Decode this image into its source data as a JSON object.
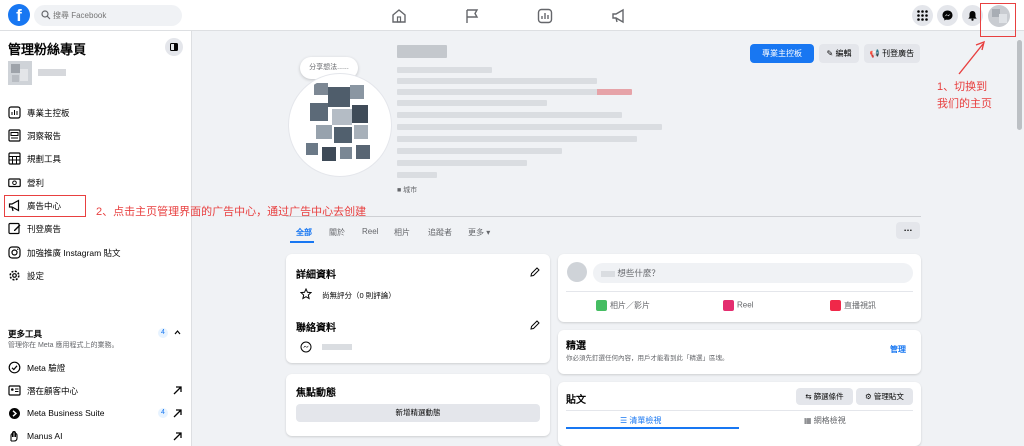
{
  "topbar": {
    "logo": "f",
    "search_placeholder": "搜尋 Facebook",
    "nav_icons": [
      "home-icon",
      "flag-icon",
      "chart-icon",
      "megaphone-icon"
    ],
    "right_icons": [
      "grid-menu-icon",
      "messenger-icon",
      "bell-icon"
    ]
  },
  "sidebar": {
    "title": "管理粉絲專頁",
    "items": [
      {
        "label": "專業主控板",
        "icon": "dashboard-icon"
      },
      {
        "label": "洞察報告",
        "icon": "insights-icon"
      },
      {
        "label": "規劃工具",
        "icon": "calendar-icon"
      },
      {
        "label": "營利",
        "icon": "money-icon"
      },
      {
        "label": "廣告中心",
        "icon": "megaphone-icon"
      },
      {
        "label": "刊登廣告",
        "icon": "edit-icon"
      },
      {
        "label": "加強推廣 Instagram 貼文",
        "icon": "instagram-icon"
      },
      {
        "label": "設定",
        "icon": "gear-icon"
      }
    ],
    "more_tools": {
      "title": "更多工具",
      "subtitle": "管理你在 Meta 應用程式上的業務。",
      "badge": "4",
      "items": [
        {
          "label": "Meta 驗證",
          "icon": "check-circle-icon"
        },
        {
          "label": "潛在顧客中心",
          "icon": "leads-icon"
        },
        {
          "label": "Meta Business Suite",
          "icon": "business-suite-icon",
          "badge": "4"
        },
        {
          "label": "Manus AI",
          "icon": "manus-icon"
        }
      ]
    }
  },
  "annotations": {
    "step1_line1": "1、切换到",
    "step1_line2": "我们的主页",
    "step2": "2、点击主页管理界面的广告中心，通过广告中心去创建"
  },
  "header": {
    "thought_bubble": "分享想法......",
    "city": "■ 城市",
    "buttons": {
      "dashboard": "專業主控板",
      "edit": "編輯",
      "ads": "刊登廣告"
    }
  },
  "tabs": [
    "全部",
    "關於",
    "Reel",
    "相片",
    "追蹤者",
    "更多 ▾"
  ],
  "about_card": {
    "title": "詳細資料",
    "rating": "尚無評分（0 則評論）",
    "contact_title": "聯絡資料"
  },
  "featured_card": {
    "title": "焦點動態",
    "button": "新增精選動態"
  },
  "composer": {
    "placeholder": "想些什麼？",
    "actions": [
      "相片／影片",
      "Reel",
      "直播視訊"
    ]
  },
  "featured_posts": {
    "title": "精選",
    "description": "你必須先釘選任何內容，用戶才能看到此「精選」區塊。",
    "manage": "管理"
  },
  "posts": {
    "title": "貼文",
    "filter": "篩選條件",
    "manage": "管理貼文",
    "views": [
      "清單檢視",
      "網格檢視"
    ]
  },
  "colors": {
    "accent": "#1877f2",
    "annotation": "#e84040"
  }
}
